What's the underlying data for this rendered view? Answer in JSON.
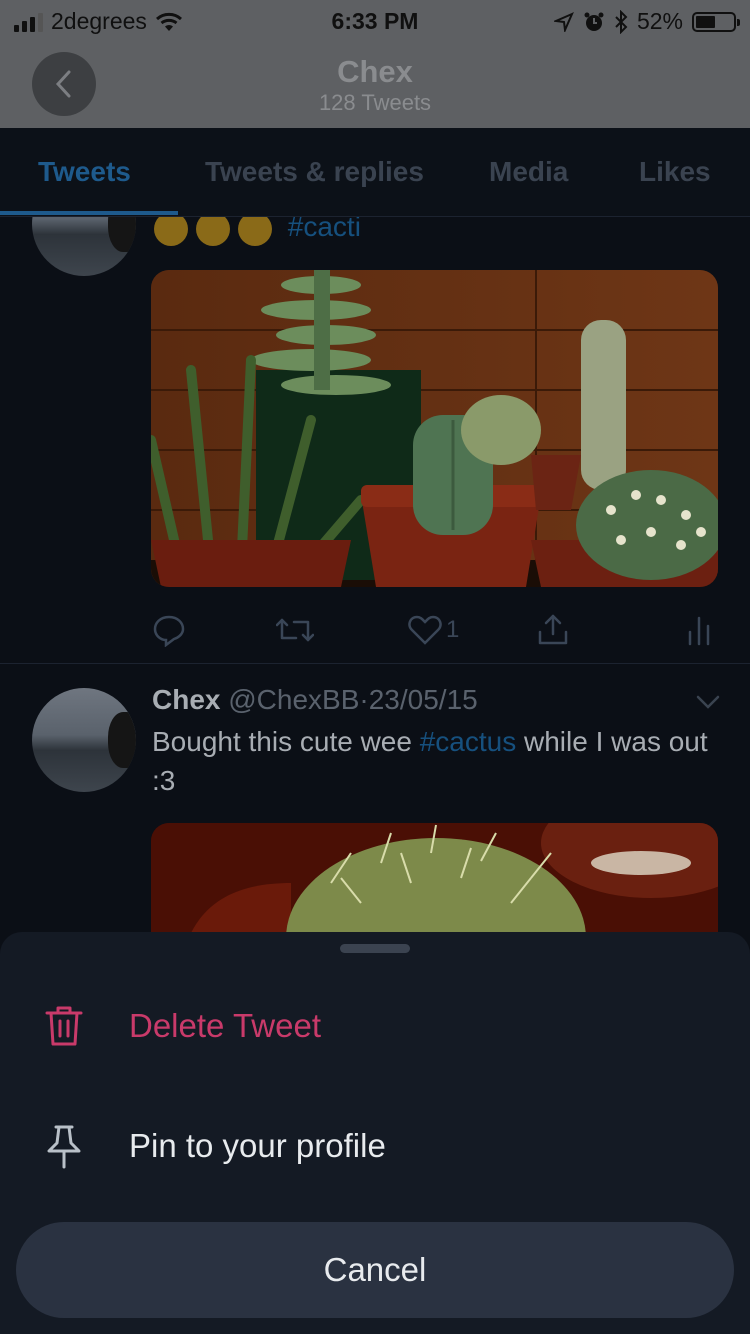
{
  "status_bar": {
    "carrier": "2degrees",
    "time": "6:33 PM",
    "battery_percent": "52%",
    "battery_level": 0.52,
    "icons": [
      "signal-icon",
      "wifi-icon",
      "location-icon",
      "alarm-icon",
      "bluetooth-icon",
      "battery-icon"
    ]
  },
  "header": {
    "name": "Chex",
    "tweet_count": "128 Tweets",
    "back_icon": "chevron-left-icon"
  },
  "tabs": [
    {
      "label": "Tweets",
      "active": true
    },
    {
      "label": "Tweets & replies",
      "active": false
    },
    {
      "label": "Media",
      "active": false
    },
    {
      "label": "Likes",
      "active": false
    }
  ],
  "tweet1": {
    "hashtag": "#cacti",
    "emoji": [
      "relieved-face-emoji",
      "relieved-face-emoji",
      "relieved-face-emoji"
    ],
    "image": "cactus-plants-photo",
    "actions": {
      "reply_icon": "reply-icon",
      "retweet_icon": "retweet-icon",
      "like_icon": "heart-icon",
      "like_count": "1",
      "share_icon": "share-icon",
      "analytics_icon": "analytics-icon"
    }
  },
  "tweet2": {
    "name": "Chex",
    "handle": "@ChexBB",
    "separator": "·",
    "date": "23/05/15",
    "text_before": "Bought this cute wee ",
    "hashtag": "#cactus",
    "text_after": " while I was out :3",
    "image": "cactus-closeup-photo",
    "menu_icon": "chevron-down-icon"
  },
  "action_sheet": {
    "delete_label": "Delete Tweet",
    "pin_label": "Pin to your profile",
    "cancel_label": "Cancel",
    "delete_color": "#c93a6a"
  },
  "colors": {
    "accent": "#1d9bf0",
    "delete": "#c93a6a",
    "sheet_bg": "#141a24"
  }
}
